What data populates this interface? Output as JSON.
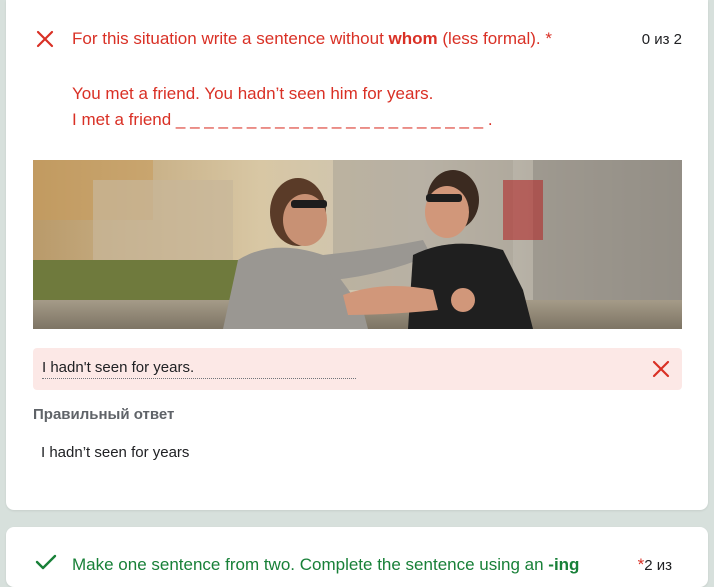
{
  "question1": {
    "title_prefix": "For this situation write a sentence without ",
    "title_bold": "whom",
    "title_suffix": " (less formal). *",
    "points": "0 из 2",
    "situation": "You met a friend. You hadn’t seen him for years.",
    "prompt": "I met a friend _ _ _ _ _ _ _ _ _ _ _ _ _ _ _ _ _ _ _ _ _ _ .",
    "user_answer": "I hadn't seen for years.",
    "correct_label": "Правильный ответ",
    "correct_answer": "I hadn’t seen for years",
    "status": "incorrect"
  },
  "question2": {
    "title_prefix": "Make one sentence from two. Complete the sentence using an ",
    "title_bold": "-ing",
    "star": "*",
    "points": "2 из",
    "status": "correct"
  },
  "colors": {
    "incorrect": "#d93025",
    "correct": "#188038",
    "error_bg": "#fce8e6",
    "page_bg": "#d7e0dc"
  }
}
